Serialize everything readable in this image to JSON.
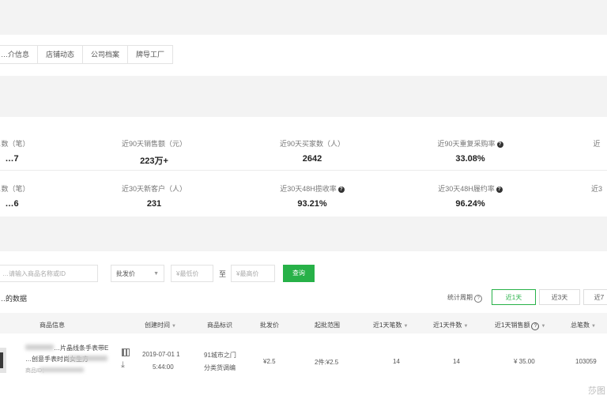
{
  "tabs": [
    "…介信息",
    "店铺动态",
    "公司档案",
    "牌导工厂"
  ],
  "stats": [
    {
      "label": "…数（笔）",
      "value": "…7"
    },
    {
      "label": "近90天销售额（元）",
      "value": "223万+"
    },
    {
      "label": "近90天买家数（人）",
      "value": "2642"
    },
    {
      "label": "近90天重复采购率",
      "value": "33.08%",
      "help": true
    },
    {
      "label": "近",
      "value": ""
    },
    {
      "label": "…数（笔）",
      "value": "…6"
    },
    {
      "label": "近30天新客户（人）",
      "value": "231"
    },
    {
      "label": "近30天48H揽收率",
      "value": "93.21%",
      "help": true
    },
    {
      "label": "近30天48H履约率",
      "value": "96.24%",
      "help": true
    },
    {
      "label": "近3",
      "value": ""
    }
  ],
  "filters": {
    "keyword_placeholder": "…请输入商品名称或ID",
    "price_type": "批发价",
    "min_placeholder": "¥最低价",
    "to": "至",
    "max_placeholder": "¥最高价",
    "search_label": "查询"
  },
  "data_title": "…的数据",
  "stat_period_label": "统计周期",
  "periods": [
    "近1天",
    "近3天",
    "近7"
  ],
  "columns": [
    "商品信息",
    "创建时间",
    "商品标识",
    "批发价",
    "起批范围",
    "近1天笔数",
    "近1天件数",
    "近1天销售额",
    "总笔数"
  ],
  "row": {
    "title_line1": "…片晶线条手表带E",
    "title_line2": "…创意手表时尚女生方",
    "sub_line": "商品ID：",
    "created_date": "2019-07-01 1",
    "created_time": "5:44:00",
    "tag_line1": "91城市之门",
    "tag_line2": "分类货调编",
    "wholesale": "¥2.5",
    "range": "2件:¥2.5",
    "orders_1d": "14",
    "pieces_1d": "14",
    "sales_1d": "¥ 35.00",
    "total_orders": "103059"
  },
  "watermark": "莎图"
}
